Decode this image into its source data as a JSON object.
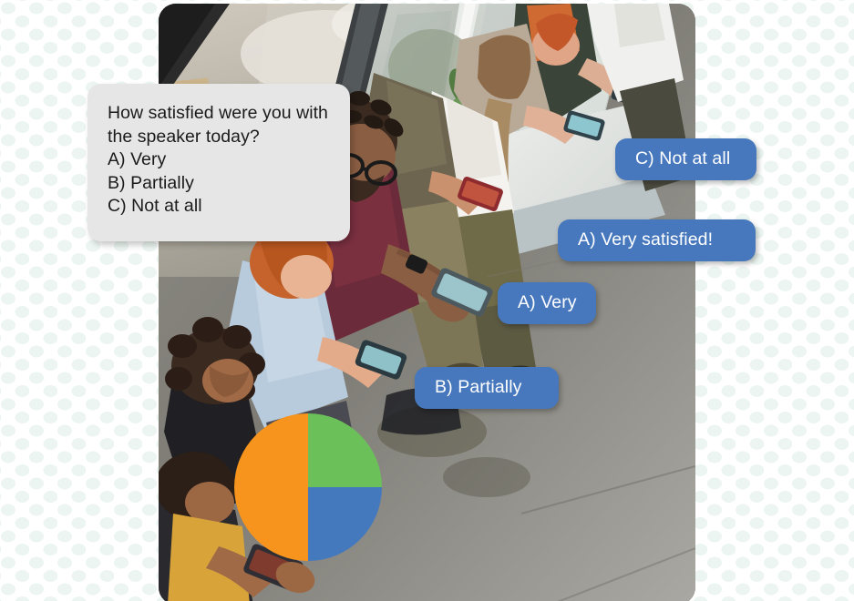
{
  "slide": {
    "background_color": "#ffffff",
    "pattern_dot_color": "#ecf5f1"
  },
  "photo": {
    "alt_name": "overhead-photo-of-people-on-phones-by-window",
    "corner_radius_px": 19
  },
  "question_card": {
    "background_color": "#e6e6e6",
    "lines": [
      "How satisfied were you with",
      "the speaker today?",
      "A) Very",
      "B) Partially",
      "C) Not at all"
    ]
  },
  "bubbles": [
    {
      "id": "c-not-at-all",
      "text": "C) Not at all",
      "color": "#4778be"
    },
    {
      "id": "a-very-satisfied",
      "text": "A) Very satisfied!",
      "color": "#4778be"
    },
    {
      "id": "a-very",
      "text": "A) Very",
      "color": "#4778be"
    },
    {
      "id": "b-partially",
      "text": "B) Partially",
      "color": "#4778be"
    }
  ],
  "chart_data": {
    "type": "pie",
    "title": "",
    "categories": [
      "A) Very",
      "B) Partially",
      "C) Not at all"
    ],
    "values": [
      25,
      25,
      50
    ],
    "unit": "percent",
    "colors": [
      "#6cc05a",
      "#4479be",
      "#f7941d"
    ],
    "legend": "none",
    "start_angle_deg": 0,
    "direction": "clockwise",
    "slices": [
      {
        "label": "A) Very",
        "value": 25,
        "color": "#6cc05a",
        "position": "top-right quadrant"
      },
      {
        "label": "B) Partially",
        "value": 25,
        "color": "#4479be",
        "position": "bottom-right quadrant"
      },
      {
        "label": "C) Not at all",
        "value": 50,
        "color": "#f7941d",
        "position": "left half"
      }
    ]
  }
}
